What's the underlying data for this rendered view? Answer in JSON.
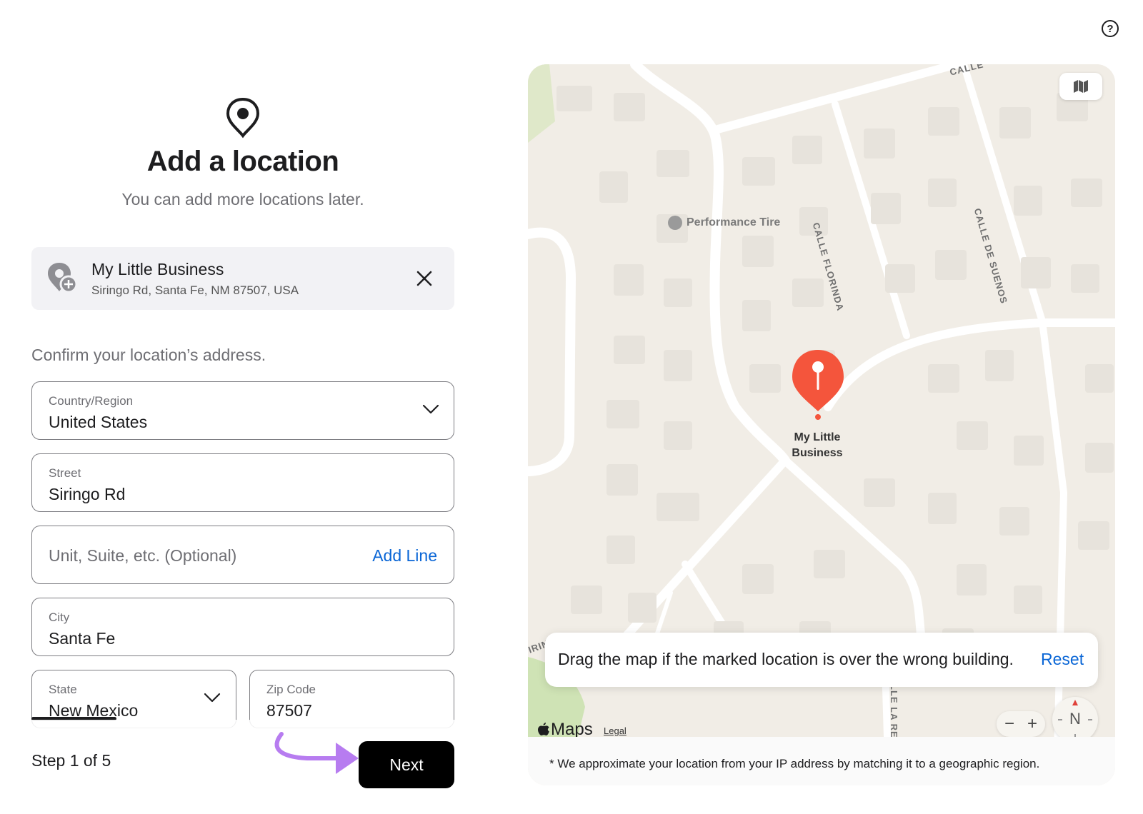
{
  "help": {
    "icon_glyph": "?"
  },
  "header": {
    "title": "Add a location",
    "subtitle": "You can add more locations later."
  },
  "business": {
    "name": "My Little Business",
    "address": "Siringo Rd, Santa Fe, NM 87507, USA"
  },
  "form": {
    "prompt": "Confirm your location’s address.",
    "country": {
      "label": "Country/Region",
      "value": "United States"
    },
    "street": {
      "label": "Street",
      "value": "Siringo Rd"
    },
    "unit": {
      "placeholder": "Unit, Suite, etc. (Optional)",
      "link": "Add Line"
    },
    "city": {
      "label": "City",
      "value": "Santa Fe"
    },
    "state": {
      "label": "State",
      "value": "New Mexico"
    },
    "zip": {
      "label": "Zip Code",
      "value": "87507"
    }
  },
  "footer": {
    "step": "Step 1 of 5",
    "next_label": "Next",
    "accent": "#000000",
    "arrow_color": "#b77cf0"
  },
  "map": {
    "poi": "Performance Tire",
    "streets": [
      "CALLE",
      "CALLE FLORINDA",
      "CALLE DE SUENOS",
      "IRIN",
      "LLE LA RESC"
    ],
    "marker_label_line1": "My Little",
    "marker_label_line2": "Business",
    "marker_color": "#f4553c",
    "tip_text": "Drag the map if the marked location is over the wrong building.",
    "reset_label": "Reset",
    "logo": "Maps",
    "legal": "Legal",
    "zoom_out": "−",
    "zoom_in": "+",
    "compass": "N",
    "footnote": "* We approximate your location from your IP address by matching it to a geographic region."
  }
}
